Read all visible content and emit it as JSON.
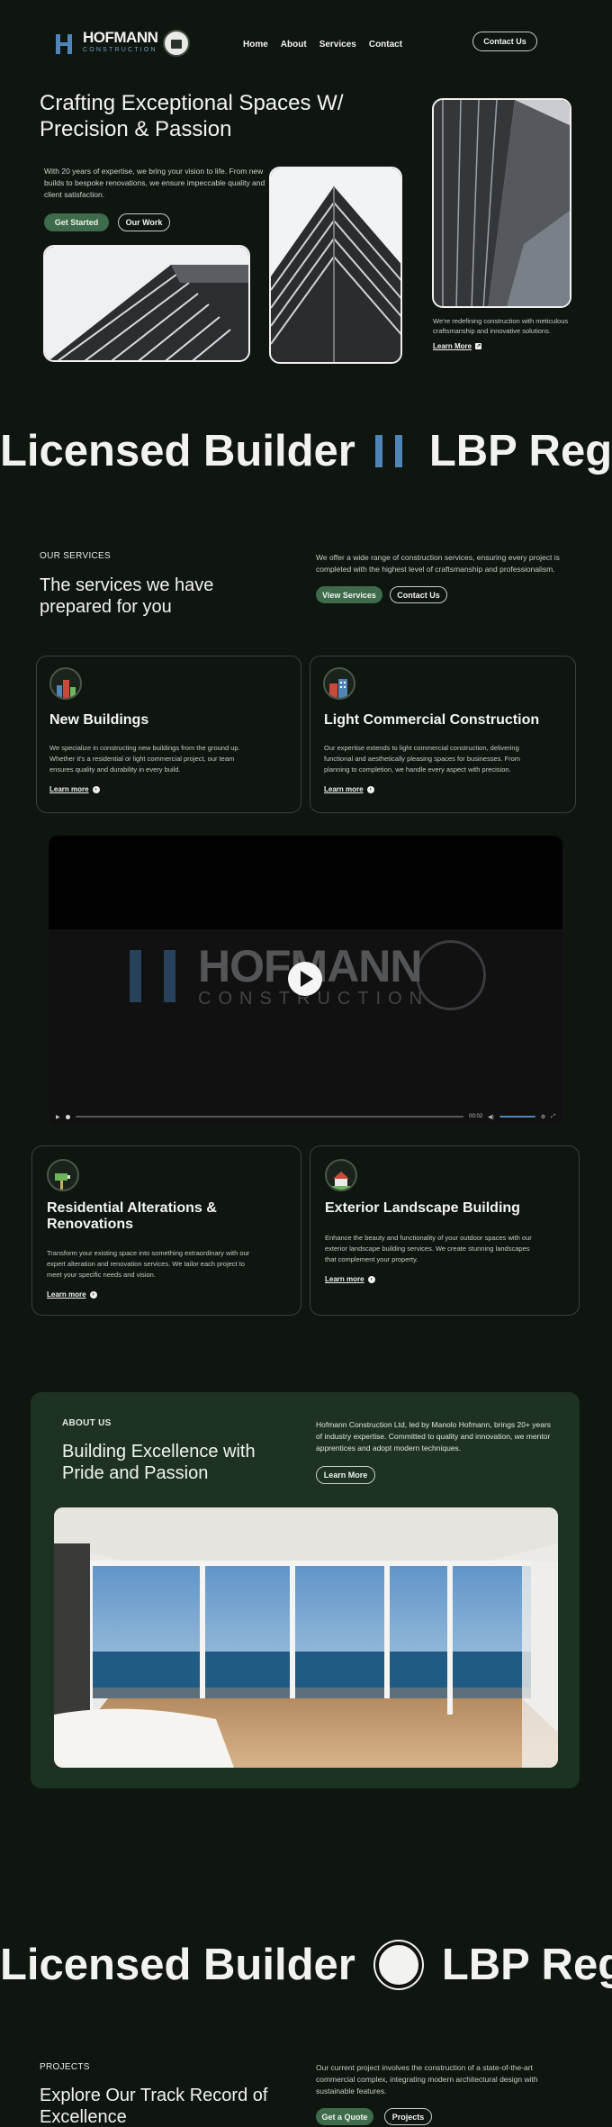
{
  "nav": {
    "brand": "HOFMANN",
    "brand_sub": "CONSTRUCTION",
    "links": [
      "Home",
      "About",
      "Services",
      "Contact"
    ],
    "cta": "Contact Us"
  },
  "hero": {
    "title": "Crafting Exceptional Spaces W/ Precision & Passion",
    "description": "With 20 years of expertise, we bring your vision to life. From new builds to bespoke renovations, we ensure impeccable quality and client satisfaction.",
    "primary_button": "Get Started",
    "secondary_button": "Our Work",
    "side_text": "We're redefining construction with meticulous craftsmanship and innovative solutions.",
    "side_link": "Learn More"
  },
  "marquee": {
    "left": "Licensed Builder",
    "right": "LBP Regis"
  },
  "services": {
    "eyebrow": "OUR SERVICES",
    "title": "The services we have prepared for you",
    "description": "We offer a wide range of construction services, ensuring every project is completed with the highest level of craftsmanship and professionalism.",
    "primary_button": "View Services",
    "secondary_button": "Contact Us",
    "cards": [
      {
        "title": "New Buildings",
        "description": "We specialize in constructing new buildings from the ground up. Whether it's a residential or light commercial project, our team ensures quality and durability in every build.",
        "link": "Learn more",
        "icon": "new-buildings-icon"
      },
      {
        "title": "Light Commercial Construction",
        "description": "Our expertise extends to light commercial construction, delivering functional and aesthetically pleasing spaces for businesses. From planning to completion, we handle every aspect with precision.",
        "link": "Learn more",
        "icon": "commercial-buildings-icon"
      },
      {
        "title": "Residential Alterations & Renovations",
        "description": "Transform your existing space into something extraordinary with our expert alteration and renovation services. We tailor each project to meet your specific needs and vision.",
        "link": "Learn more",
        "icon": "renovation-paint-roller-icon"
      },
      {
        "title": "Exterior Landscape Building",
        "description": "Enhance the beauty and functionality of your outdoor spaces with our exterior landscape building services. We create stunning landscapes that complement your property.",
        "link": "Learn more",
        "icon": "landscape-house-icon"
      }
    ]
  },
  "video": {
    "brand": "HOFMANN",
    "brand_sub": "CONSTRUCTION",
    "time": "00:02"
  },
  "about": {
    "eyebrow": "ABOUT US",
    "title": "Building Excellence with Pride and Passion",
    "description": "Hofmann Construction Ltd, led by Manolo Hofmann, brings 20+ years of industry expertise. Committed to quality and innovation, we mentor apprentices and adopt modern techniques.",
    "button": "Learn More"
  },
  "projects": {
    "eyebrow": "PROJECTS",
    "title": "Explore Our Track Record of Excellence",
    "description": "Our current project involves the construction of a state-of-the-art commercial complex, integrating modern architectural design with sustainable features.",
    "primary_button": "Get a Quote",
    "secondary_button": "Projects"
  },
  "colors": {
    "background": "#0f150f",
    "accent_green": "#3d6b4b",
    "brand_blue": "#4f86b7",
    "about_panel": "#1d3223"
  }
}
